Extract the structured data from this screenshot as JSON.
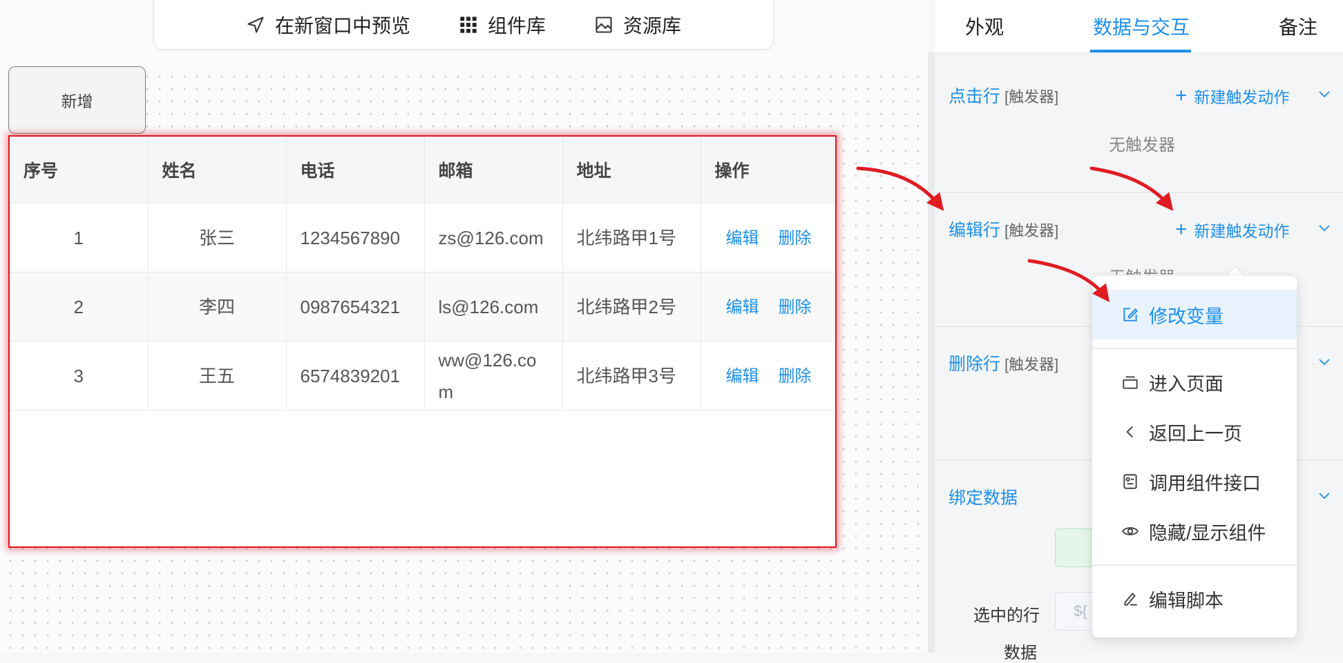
{
  "toolbar": {
    "preview": "在新窗口中预览",
    "components": "组件库",
    "resources": "资源库"
  },
  "canvas": {
    "add_button": "新增",
    "table": {
      "headers": [
        "序号",
        "姓名",
        "电话",
        "邮箱",
        "地址",
        "操作"
      ],
      "rows": [
        {
          "no": "1",
          "name": "张三",
          "phone": "1234567890",
          "email": "zs@126.com",
          "address": "北纬路甲1号"
        },
        {
          "no": "2",
          "name": "李四",
          "phone": "0987654321",
          "email": "ls@126.com",
          "address": "北纬路甲2号"
        },
        {
          "no": "3",
          "name": "王五",
          "phone": "6574839201",
          "email": "ww@126.com",
          "address": "北纬路甲3号"
        }
      ],
      "edit_label": "编辑",
      "delete_label": "删除"
    }
  },
  "panel": {
    "tabs": [
      "外观",
      "数据与交互",
      "备注"
    ],
    "active_tab": "数据与交互",
    "trigger_tag": "[触发器]",
    "new_action": "新建触发动作",
    "no_trigger": "无触发器",
    "sections": {
      "click_row": "点击行",
      "edit_row": "编辑行",
      "delete_row": "删除行",
      "bind_data": "绑定数据"
    },
    "selected_label_1": "选中的行",
    "selected_label_2": "数据",
    "input_placeholder": "${"
  },
  "menu": {
    "items": [
      {
        "label": "修改变量",
        "icon": "edit-square-icon"
      },
      {
        "label": "进入页面",
        "icon": "page-stack-icon"
      },
      {
        "label": "返回上一页",
        "icon": "chevron-left-icon"
      },
      {
        "label": "调用组件接口",
        "icon": "component-api-icon"
      },
      {
        "label": "隐藏/显示组件",
        "icon": "eye-icon"
      },
      {
        "label": "编辑脚本",
        "icon": "pencil-script-icon"
      }
    ]
  },
  "colors": {
    "accent": "#1e8fea",
    "selection_border": "#e1141e",
    "annotation_arrow": "#e01b22"
  }
}
